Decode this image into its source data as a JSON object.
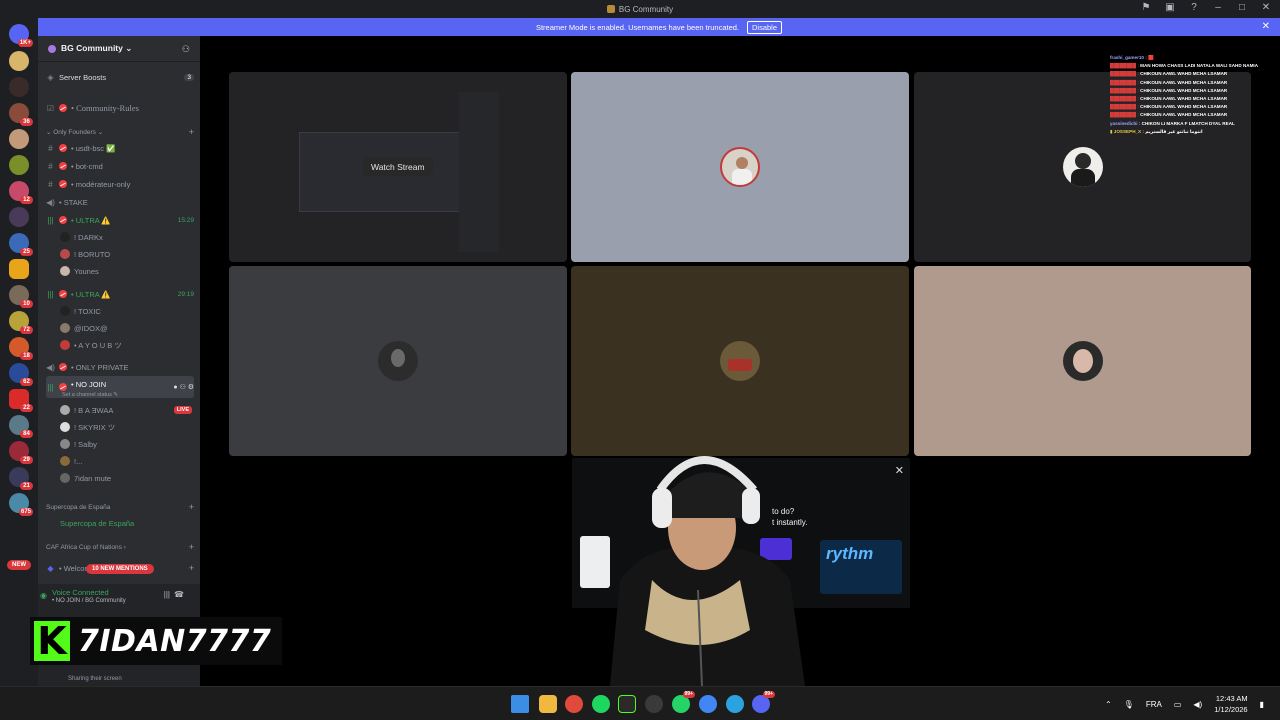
{
  "window": {
    "title": "BG Community"
  },
  "banner": {
    "message": "Streamer Mode is enabled. Usernames have been truncated.",
    "button": "Disable"
  },
  "guild": {
    "name": "BG Community ⌄"
  },
  "sidebar": {
    "server_boosts": {
      "label": "Server Boosts",
      "count": "3"
    },
    "community_rules": "• Community-Rules",
    "category_founders": "⌄ Only Founders ⌄",
    "channels": [
      {
        "label": "• usdt-bsc ✅"
      },
      {
        "label": "• bot-cmd"
      },
      {
        "label": "• modérateur-only"
      },
      {
        "label": "• STAKE"
      }
    ],
    "voice1": {
      "label": "• ULTRA ⚠️",
      "time": "15:29",
      "users": [
        "! DARKx",
        "! BORUTO",
        "Younes"
      ]
    },
    "voice2": {
      "label": "• ULTRA ⚠️",
      "time": "29:19",
      "users": [
        "! TOXIC",
        "@IDOX@",
        "• A Y O U B ツ"
      ]
    },
    "only_private": "• ONLY PRIVATE",
    "no_join": {
      "label": "• NO JOIN",
      "status": "Set a channel status ✎",
      "users": [
        "! B A ƎWAA",
        "! SKYRIX ツ",
        "! Salby",
        "!...",
        "7idan mute"
      ],
      "live": "LIVE"
    },
    "category_supercopa": "Supercopa de España",
    "supercopa": "Supercopa de España",
    "category_caf": "CAF Africa Cup of Nations ›",
    "welcome": "• Welcom",
    "mentions": "10 NEW MENTIONS"
  },
  "voice_panel": {
    "status": "Voice Connected",
    "channel": "• NO JOIN / BG Community",
    "sharing": "Sharing their screen"
  },
  "overlay": {
    "kick_letter": "K",
    "streamer": "7IDAN7777"
  },
  "stage": {
    "watch_stream": "Watch Stream"
  },
  "chat": [
    {
      "user": "frashi_gamer10 :",
      "msg": "🟥"
    },
    {
      "user": "████████ :",
      "msg": "MAN HOWA CHASS LADI NATALA WALI SAHD NAMIA"
    },
    {
      "user": "████████ :",
      "msg": "CHIKOUN AAWL WAHD MCHA LSAMAR"
    },
    {
      "user": "████████ :",
      "msg": "CHIKOUN AAWL WAHD MCHA LSAMAR"
    },
    {
      "user": "████████ :",
      "msg": "CHIKOUN AAWL WAHD MCHA LSAMAR"
    },
    {
      "user": "████████ :",
      "msg": "CHIKOUN AAWL WAHD MCHA LSAMAR"
    },
    {
      "user": "████████ :",
      "msg": "CHIKOUN AAWL WAHD MCHA LSAMAR"
    },
    {
      "user": "████████ :",
      "msg": "CHIKOUN AAWL WAHD MCHA LSAMAR"
    },
    {
      "user": "yassinedichi :",
      "msg": "CHIKON LI MARKA F LMATCH DYAL REAL"
    },
    {
      "user": "▮ JOSSEPH_X :",
      "msg": "انتوما تبانتو غير فالستريم"
    }
  ],
  "promo": {
    "line1": "to do?",
    "line2": "t instantly.",
    "brand": "rythm"
  },
  "rail_badges": [
    "1K+",
    "36",
    "12",
    "25",
    "10",
    "72",
    "18",
    "62",
    "22",
    "84",
    "29",
    "21",
    "675"
  ],
  "rail_new": "NEW",
  "taskbar": {
    "lang": "FRA",
    "time": "12:43 AM",
    "date": "1/12/2026",
    "badge_a": "99+",
    "badge_b": "99+"
  },
  "colors": {
    "blurple": "#5865f2",
    "green": "#3ba55c",
    "red": "#da373c",
    "kick": "#53fc18"
  }
}
